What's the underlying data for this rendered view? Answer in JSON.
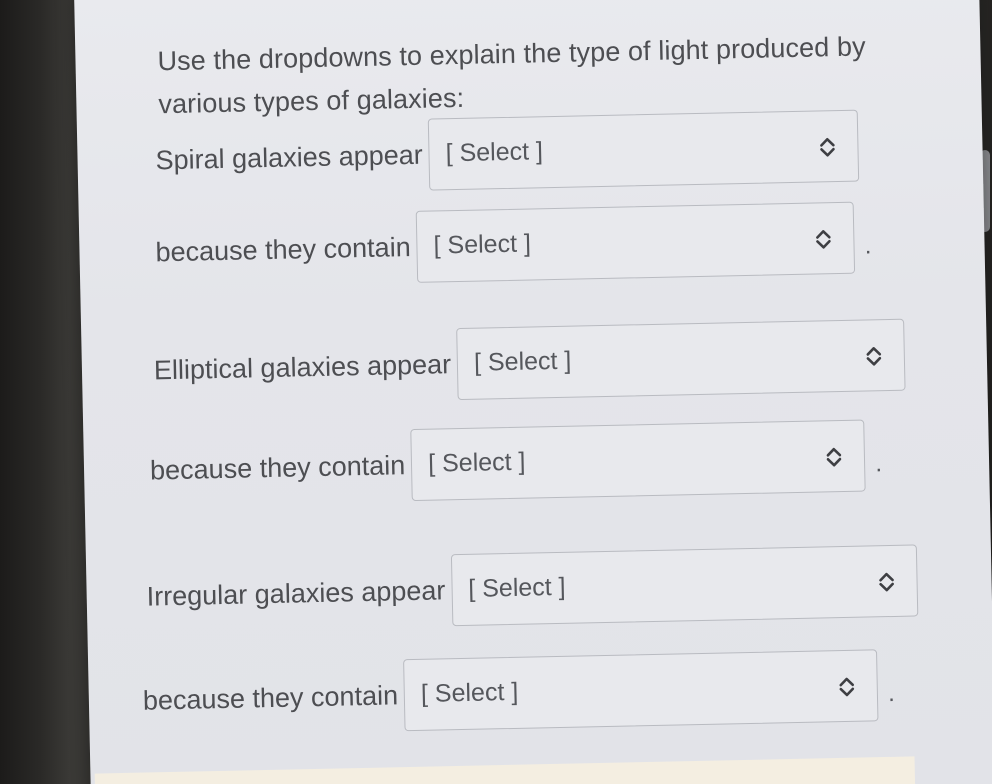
{
  "prompt": "Use the dropdowns to explain the type of light produced by various types of galaxies:",
  "rows": [
    {
      "label": "Spiral galaxies appear",
      "select_value": "[ Select ]",
      "suffix": ""
    },
    {
      "label": "because they contain",
      "select_value": "[ Select ]",
      "suffix": "."
    },
    {
      "label": "Elliptical galaxies appear",
      "select_value": "[ Select ]",
      "suffix": ""
    },
    {
      "label": "because they contain",
      "select_value": "[ Select ]",
      "suffix": "."
    },
    {
      "label": "Irregular galaxies appear",
      "select_value": "[ Select ]",
      "suffix": ""
    },
    {
      "label": "because they contain",
      "select_value": "[ Select ]",
      "suffix": "."
    }
  ],
  "icons": {
    "dropdown": "chevron-up-down-icon"
  },
  "colors": {
    "panel_bg": "#e4e5ea",
    "text": "#4d4e52",
    "border": "#b9bbc1"
  }
}
